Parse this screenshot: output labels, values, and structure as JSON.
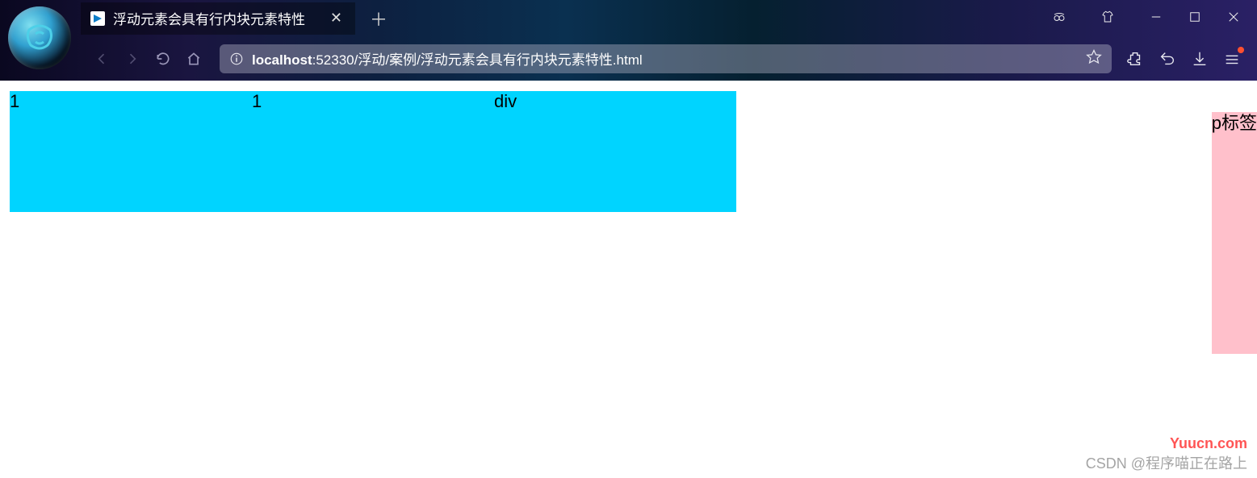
{
  "browser": {
    "tab": {
      "title": "浮动元素会具有行内块元素特性"
    },
    "url": {
      "host": "localhost",
      "rest": ":52330/浮动/案例/浮动元素会具有行内块元素特性.html"
    }
  },
  "content": {
    "box1": "1",
    "box2": "1",
    "box3": "div",
    "p_label": "p标签"
  },
  "watermarks": {
    "site": "Yuucn.com",
    "csdn": "CSDN @程序喵正在路上"
  }
}
